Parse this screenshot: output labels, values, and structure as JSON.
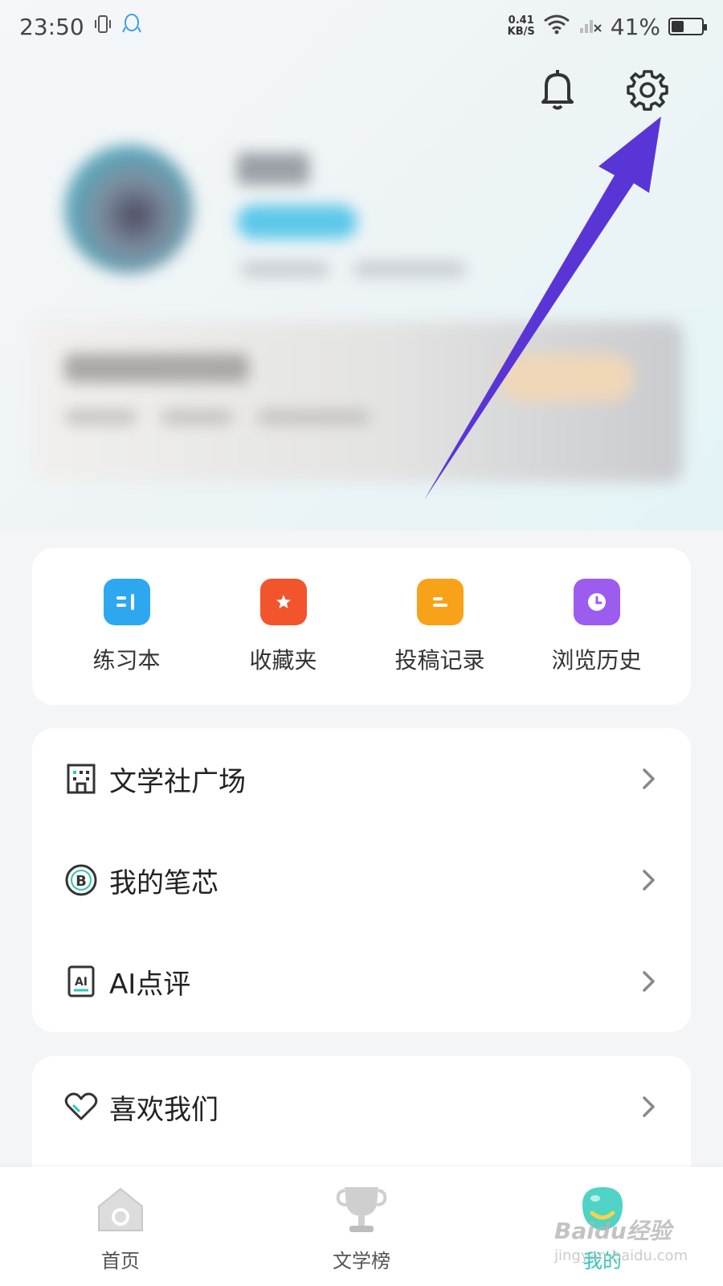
{
  "status_bar": {
    "time": "23:50",
    "net_speed_value": "0.41",
    "net_speed_unit": "KB/S",
    "battery_percent": "41%",
    "battery_level": 0.41
  },
  "header": {
    "bell_icon": "bell-icon",
    "settings_icon": "gear-icon"
  },
  "shortcuts": [
    {
      "label": "练习本",
      "icon": "notebook-icon",
      "color": "#2da8f0"
    },
    {
      "label": "收藏夹",
      "icon": "bookmark-star-icon",
      "color": "#f2552c"
    },
    {
      "label": "投稿记录",
      "icon": "document-icon",
      "color": "#f8a21a"
    },
    {
      "label": "浏览历史",
      "icon": "clock-icon",
      "color": "#9d5cf0"
    }
  ],
  "menu": [
    {
      "label": "文学社广场",
      "icon": "building-icon"
    },
    {
      "label": "我的笔芯",
      "icon": "coin-b-icon"
    },
    {
      "label": "AI点评",
      "icon": "ai-document-icon"
    }
  ],
  "menu2": [
    {
      "label": "喜欢我们",
      "icon": "heart-icon"
    }
  ],
  "bottom_nav": [
    {
      "label": "首页",
      "icon": "home-icon",
      "active": false
    },
    {
      "label": "文学榜",
      "icon": "trophy-icon",
      "active": false
    },
    {
      "label": "我的",
      "icon": "mine-icon",
      "active": true
    }
  ],
  "watermark": {
    "text": "Baidu经验",
    "sub": "jingyan.baidu.com"
  },
  "colors": {
    "accent": "#2cc7b8",
    "arrow": "#5a35d6"
  }
}
